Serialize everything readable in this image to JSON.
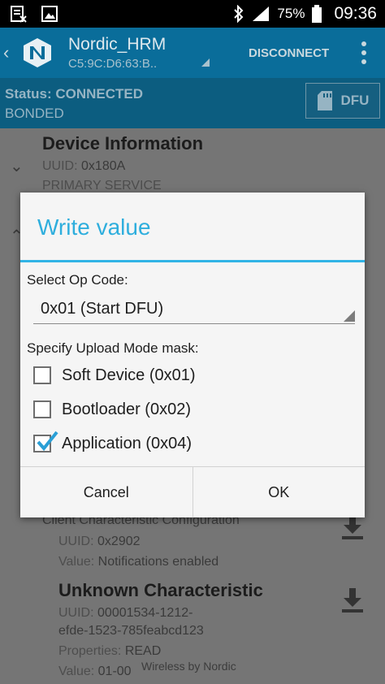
{
  "status_bar": {
    "battery": "75%",
    "time": "09:36",
    "icons": [
      "clipboard-notification-icon",
      "image-notification-icon",
      "bluetooth-icon",
      "signal-icon",
      "battery-icon"
    ]
  },
  "app_bar": {
    "title": "Nordic_HRM",
    "subtitle": "C5:9C:D6:63:B..",
    "disconnect_label": "DISCONNECT"
  },
  "status": {
    "line1": "Status: CONNECTED",
    "line2": "BONDED",
    "dfu_label": "DFU"
  },
  "background": {
    "service_title": "Device Information",
    "service_uuid_label": "UUID:",
    "service_uuid_value": "0x180A",
    "service_type": "PRIMARY SERVICE",
    "descriptor_title": "Client Characteristic Configuration",
    "descriptor_uuid_label": "UUID:",
    "descriptor_uuid_value": "0x2902",
    "descriptor_value_label": "Value:",
    "descriptor_value_value": "Notifications enabled",
    "char_title": "Unknown Characteristic",
    "char_uuid_label": "UUID:",
    "char_uuid_value_line1": "00001534-1212-",
    "char_uuid_value_line2": "efde-1523-785feabcd123",
    "char_props_label": "Properties:",
    "char_props_value": "READ",
    "char_value_label": "Value:",
    "char_value_value": "01-00",
    "footer": "Wireless by Nordic"
  },
  "dialog": {
    "title": "Write value",
    "opcode_label": "Select Op Code:",
    "opcode_selected": "0x01 (Start DFU)",
    "mask_label": "Specify Upload Mode mask:",
    "options": [
      {
        "label": "Soft Device (0x01)",
        "checked": false
      },
      {
        "label": "Bootloader (0x02)",
        "checked": false
      },
      {
        "label": "Application (0x04)",
        "checked": true
      }
    ],
    "cancel_label": "Cancel",
    "ok_label": "OK"
  },
  "colors": {
    "accent": "#31b4e6",
    "app_bar": "#0a6d9a",
    "status_strip": "#0c5d80"
  }
}
